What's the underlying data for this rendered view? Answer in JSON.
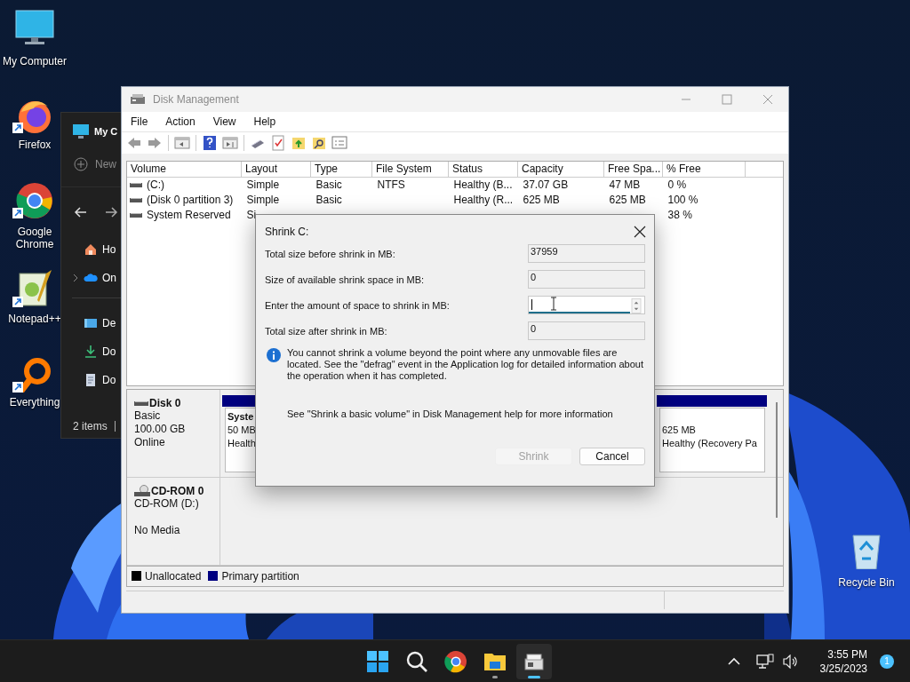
{
  "desktop_icons": [
    {
      "label": "My Computer",
      "kind": "monitor",
      "shortcut": false
    },
    {
      "label": "Firefox",
      "kind": "firefox",
      "shortcut": true
    },
    {
      "label": "Google Chrome",
      "kind": "chrome",
      "shortcut": true
    },
    {
      "label": "Notepad++",
      "kind": "notepad",
      "shortcut": true
    },
    {
      "label": "Everything",
      "kind": "everything",
      "shortcut": true
    },
    {
      "label": "Recycle Bin",
      "kind": "recycle",
      "shortcut": false
    }
  ],
  "explorer": {
    "title": "My C",
    "new_button": "New",
    "nav_groups": [
      [
        {
          "label": "Ho",
          "kind": "home",
          "expandable": false
        },
        {
          "label": "On",
          "kind": "cloud",
          "expandable": true
        }
      ],
      [
        {
          "label": "De",
          "kind": "desktop",
          "expandable": false
        },
        {
          "label": "Do",
          "kind": "download",
          "expandable": false
        },
        {
          "label": "Do",
          "kind": "document",
          "expandable": false
        }
      ]
    ],
    "status": "2 items"
  },
  "disk_management": {
    "title": "Disk Management",
    "menu": [
      "File",
      "Action",
      "View",
      "Help"
    ],
    "volume_table": {
      "columns": [
        "Volume",
        "Layout",
        "Type",
        "File System",
        "Status",
        "Capacity",
        "Free Spa...",
        "% Free"
      ],
      "rows": [
        {
          "cells": [
            "(C:)",
            "Simple",
            "Basic",
            "NTFS",
            "Healthy (B...",
            "37.07 GB",
            "47 MB",
            "0 %"
          ]
        },
        {
          "cells": [
            "(Disk 0 partition 3)",
            "Simple",
            "Basic",
            null,
            "Healthy (R...",
            "625 MB",
            "625 MB",
            "100 %"
          ]
        },
        {
          "cells": [
            "System Reserved",
            "Si",
            null,
            null,
            null,
            null,
            null,
            "38 %"
          ]
        }
      ]
    },
    "disks": [
      {
        "name": "Disk 0",
        "kind": "hdd",
        "type": "Basic",
        "size": "100.00 GB",
        "status": "Online",
        "partitions": [
          {
            "title": "Syste",
            "size": "50 MB",
            "status": "Health"
          },
          {
            "size": "625 MB",
            "status": "Healthy (Recovery Pa"
          }
        ]
      },
      {
        "name": "CD-ROM 0",
        "kind": "cdrom",
        "type": "CD-ROM (D:)",
        "status": "No Media"
      }
    ],
    "legend": [
      {
        "label": "Unallocated",
        "color": "#000000"
      },
      {
        "label": "Primary partition",
        "color": "#000080"
      }
    ]
  },
  "dialog": {
    "title": "Shrink C:",
    "fields": [
      {
        "label": "Total size before shrink in MB:",
        "value": "37959",
        "kind": "readonly"
      },
      {
        "label": "Size of available shrink space in MB:",
        "value": "0",
        "kind": "readonly"
      },
      {
        "label": "Enter the amount of space to shrink in MB:",
        "kind": "spin",
        "focused": true
      },
      {
        "label": "Total size after shrink in MB:",
        "value": "0",
        "kind": "readonly"
      }
    ],
    "info": "You cannot shrink a volume beyond the point where any unmovable files are located. See the \"defrag\" event in the Application log for detailed information about the operation when it has completed.",
    "help": "See \"Shrink a basic volume\" in Disk Management help for more information",
    "buttons": [
      {
        "label": "Shrink",
        "disabled": true
      },
      {
        "label": "Cancel",
        "disabled": false
      }
    ]
  },
  "taskbar": {
    "apps": [
      {
        "kind": "start",
        "running": false,
        "active": false
      },
      {
        "kind": "search",
        "running": false,
        "active": false
      },
      {
        "kind": "chrome",
        "running": false,
        "active": false
      },
      {
        "kind": "folder",
        "running": true,
        "active": false
      },
      {
        "kind": "diskmgmt",
        "running": true,
        "active": true
      }
    ],
    "time": "3:55 PM",
    "date": "3/25/2023",
    "notifications": "1"
  }
}
